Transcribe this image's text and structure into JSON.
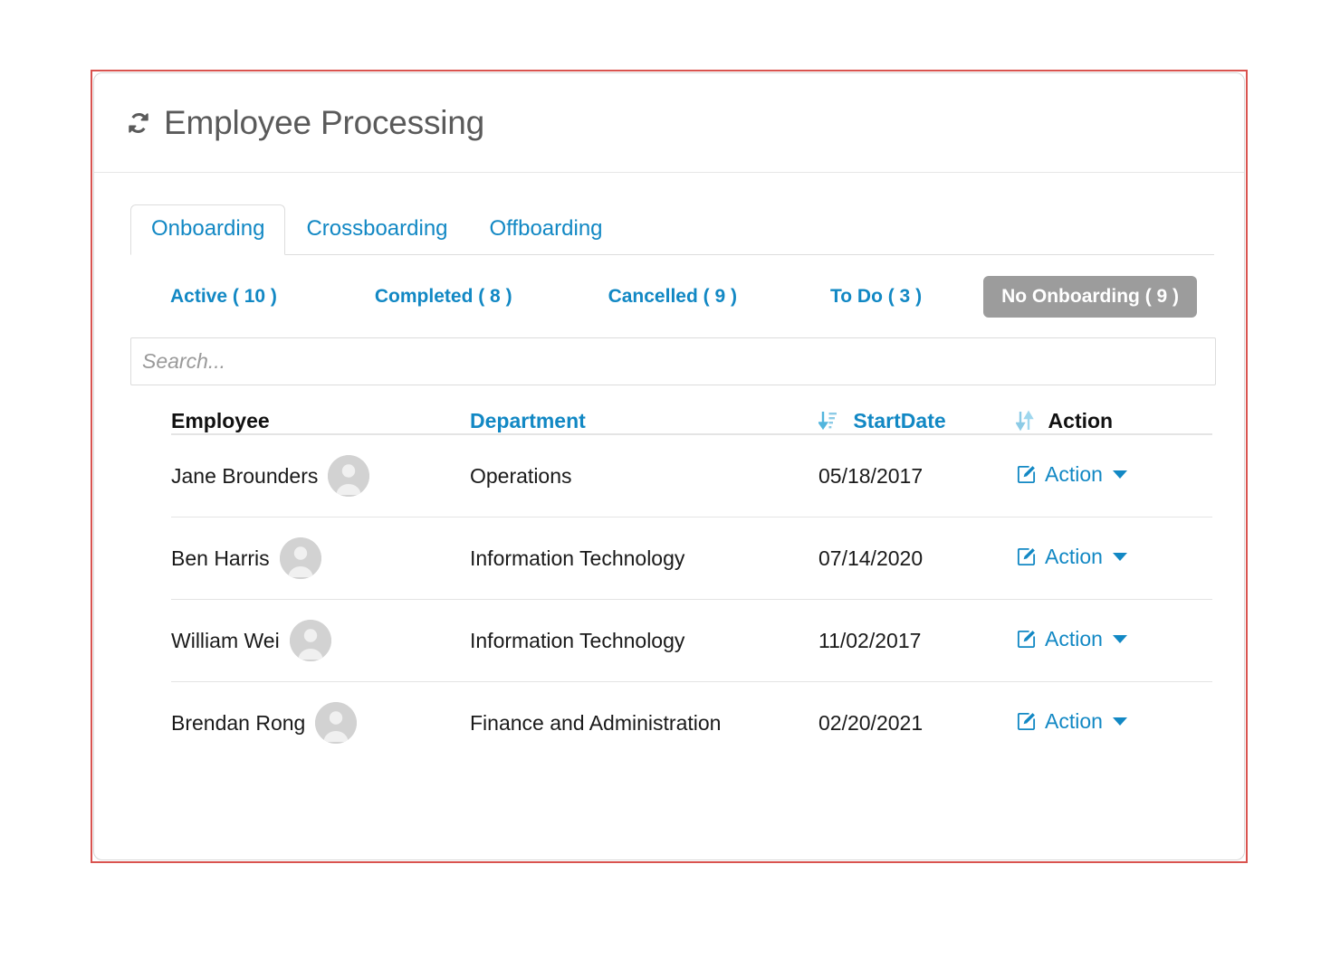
{
  "header": {
    "title": "Employee Processing",
    "icon": "sync-icon"
  },
  "tabs": [
    {
      "label": "Onboarding",
      "active": true
    },
    {
      "label": "Crossboarding",
      "active": false
    },
    {
      "label": "Offboarding",
      "active": false
    }
  ],
  "subfilters": [
    {
      "label": "Active ( 10 )",
      "selected": false
    },
    {
      "label": "Completed ( 8 )",
      "selected": false
    },
    {
      "label": "Cancelled ( 9 )",
      "selected": false
    },
    {
      "label": "To Do ( 3 )",
      "selected": false
    },
    {
      "label": "No Onboarding ( 9 )",
      "selected": true
    }
  ],
  "search": {
    "value": "",
    "placeholder": "Search..."
  },
  "table": {
    "columns": [
      {
        "label": "Employee",
        "sortable": false,
        "sort_icon": ""
      },
      {
        "label": "Department",
        "sortable": true,
        "sort_icon": ""
      },
      {
        "label": "StartDate",
        "sortable": true,
        "sort_icon": "sort-amount-desc-icon"
      },
      {
        "label": "Action",
        "sortable": false,
        "sort_icon": "sort-icon"
      }
    ],
    "rows": [
      {
        "employee": "Jane Brounders",
        "department": "Operations",
        "start_date": "05/18/2017",
        "action_label": "Action"
      },
      {
        "employee": "Ben Harris",
        "department": "Information Technology",
        "start_date": "07/14/2020",
        "action_label": "Action"
      },
      {
        "employee": "William Wei",
        "department": "Information Technology",
        "start_date": "11/02/2017",
        "action_label": "Action"
      },
      {
        "employee": "Brendan Rong",
        "department": "Finance and Administration",
        "start_date": "02/20/2021",
        "action_label": "Action"
      }
    ]
  },
  "colors": {
    "link_blue": "#1288c4",
    "sort_icon_blue": "#9fd2ea",
    "pill_gray": "#9c9c9c",
    "highlight_red": "#d9534f",
    "title_gray": "#5a5a5a"
  }
}
